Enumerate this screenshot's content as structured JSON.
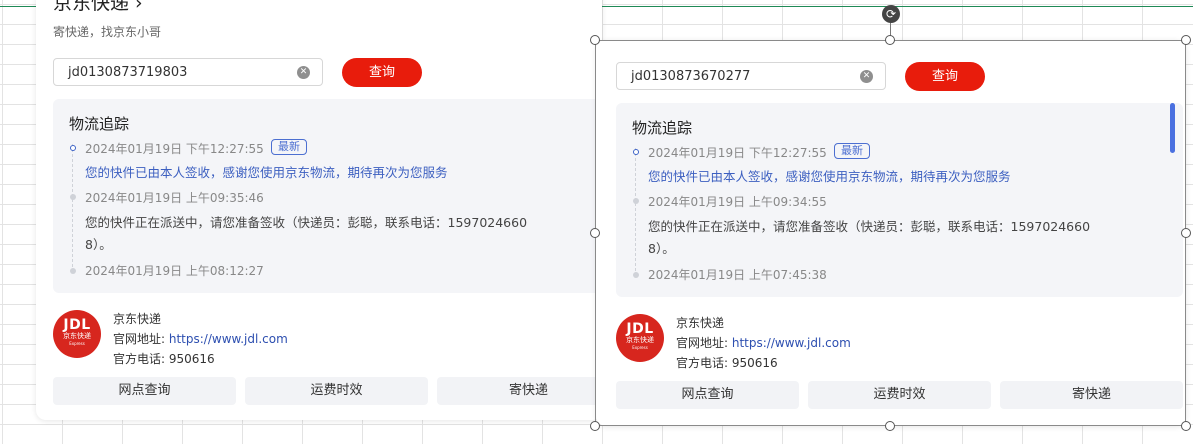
{
  "left_card": {
    "title": "京东快递 ›",
    "subtitle": "寄快递，找京东小哥",
    "search_value": "jd0130873719803",
    "query_label": "查询",
    "track_title": "物流追踪",
    "events": [
      {
        "time": "2024年01月19日 下午12:27:55",
        "badge": "最新",
        "text": "您的快件已由本人签收，感谢您使用京东物流，期待再次为您服务"
      },
      {
        "time": "2024年01月19日 上午09:35:46",
        "text_line1": "您的快件正在派送中，请您准备签收（快递员：彭聪，联系电话：1597024660",
        "text_line2": "8）。"
      },
      {
        "time": "2024年01月19日 上午08:12:27"
      }
    ],
    "company": "京东快递",
    "website_label": "官网地址:",
    "website_url": "https://www.jdl.com",
    "phone_label": "官方电话:",
    "phone": "950616",
    "tabs": [
      "网点查询",
      "运费时效",
      "寄快递"
    ]
  },
  "right_card": {
    "search_value": "jd0130873670277",
    "query_label": "查询",
    "track_title": "物流追踪",
    "events": [
      {
        "time": "2024年01月19日 下午12:27:55",
        "badge": "最新",
        "text": "您的快件已由本人签收，感谢您使用京东物流，期待再次为您服务"
      },
      {
        "time": "2024年01月19日 上午09:34:55",
        "text_line1": "您的快件正在派送中，请您准备签收（快递员：彭聪，联系电话：1597024660",
        "text_line2": "8）。"
      },
      {
        "time": "2024年01月19日 上午07:45:38"
      }
    ],
    "company": "京东快递",
    "website_label": "官网地址:",
    "website_url": "https://www.jdl.com",
    "phone_label": "官方电话:",
    "phone": "950616",
    "tabs": [
      "网点查询",
      "运费时效",
      "寄快递"
    ]
  },
  "logo": {
    "line1": "JDL",
    "line2": "京东快递",
    "line3": "Express"
  },
  "icons": {
    "clear": "clear-circle-icon",
    "rotate": "rotate-handle-icon"
  },
  "colors": {
    "accent_red": "#e81c0c",
    "link_blue": "#3c5fc0",
    "panel_bg": "#f4f5f8"
  }
}
